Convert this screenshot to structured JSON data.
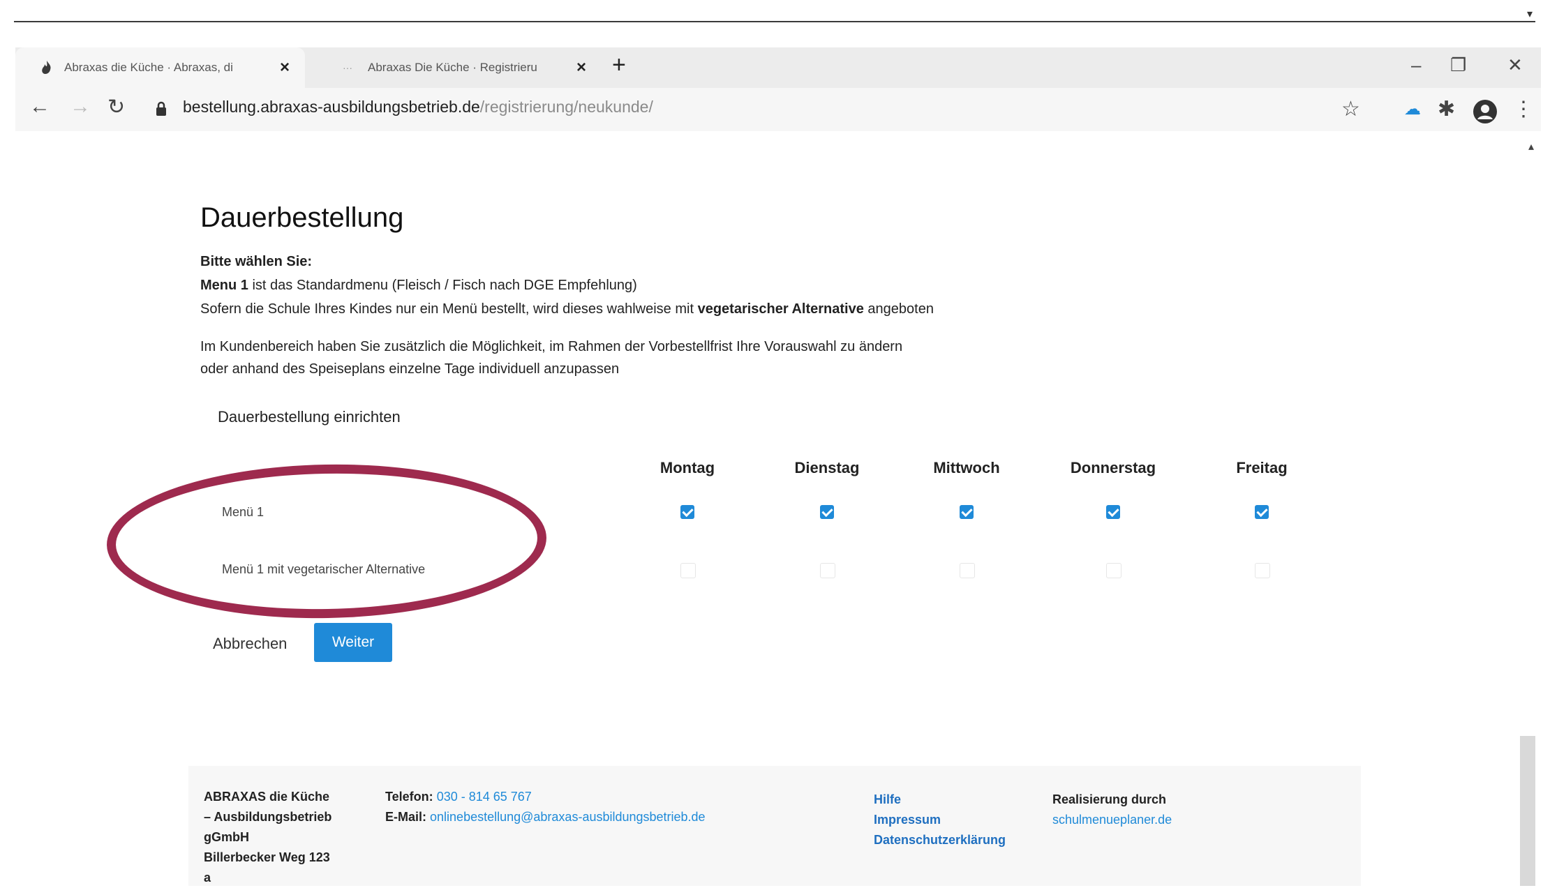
{
  "browser": {
    "tabs": [
      {
        "title": "Abraxas die Küche · Abraxas, di"
      },
      {
        "title": "Abraxas Die Küche · Registrieru"
      }
    ],
    "url_host": "bestellung.abraxas-ausbildungsbetrieb.de",
    "url_path": "/registrierung/neukunde/"
  },
  "page": {
    "title": "Dauerbestellung",
    "choose_label": "Bitte wählen Sie:",
    "menu1_bold": "Menu 1",
    "menu1_text": " ist das Standardmenu (Fleisch / Fisch nach DGE Empfehlung)",
    "vegetarian_text_a": "Sofern die Schule Ihres Kindes nur ein Menü bestellt, wird dieses wahlweise mit ",
    "vegetarian_bold": "vegetarischer Alternative",
    "vegetarian_text_b": " angeboten",
    "info_line1": "Im Kundenbereich haben Sie zusätzlich die Möglichkeit, im Rahmen der Vorbestellfrist Ihre Vorauswahl zu ändern",
    "info_line2": "oder anhand des Speiseplans einzelne Tage individuell anzupassen",
    "subheading": "Dauerbestellung einrichten",
    "days": [
      "Montag",
      "Dienstag",
      "Mittwoch",
      "Donnerstag",
      "Freitag"
    ],
    "rows": [
      {
        "label": "Menü 1",
        "checked": [
          true,
          true,
          true,
          true,
          true
        ]
      },
      {
        "label": "Menü 1 mit vegetarischer Alternative",
        "checked": [
          false,
          false,
          false,
          false,
          false
        ]
      }
    ],
    "cancel_label": "Abbrechen",
    "next_label": "Weiter"
  },
  "footer": {
    "address": [
      "ABRAXAS die Küche",
      "– Ausbildungsbetrieb",
      "gGmbH",
      "Billerbecker Weg 123",
      "a"
    ],
    "phone_label": "Telefon:",
    "phone": "030 - 814 65 767",
    "email_label": "E-Mail:",
    "email": "onlinebestellung@abraxas-ausbildungsbetrieb.de",
    "links": [
      "Hilfe",
      "Impressum",
      "Datenschutzerklärung"
    ],
    "realization_label": "Realisierung durch",
    "realization_link": "schulmenueplaner.de"
  },
  "colors": {
    "accent": "#1f8ad8",
    "annotation": "#9e2a4e"
  }
}
